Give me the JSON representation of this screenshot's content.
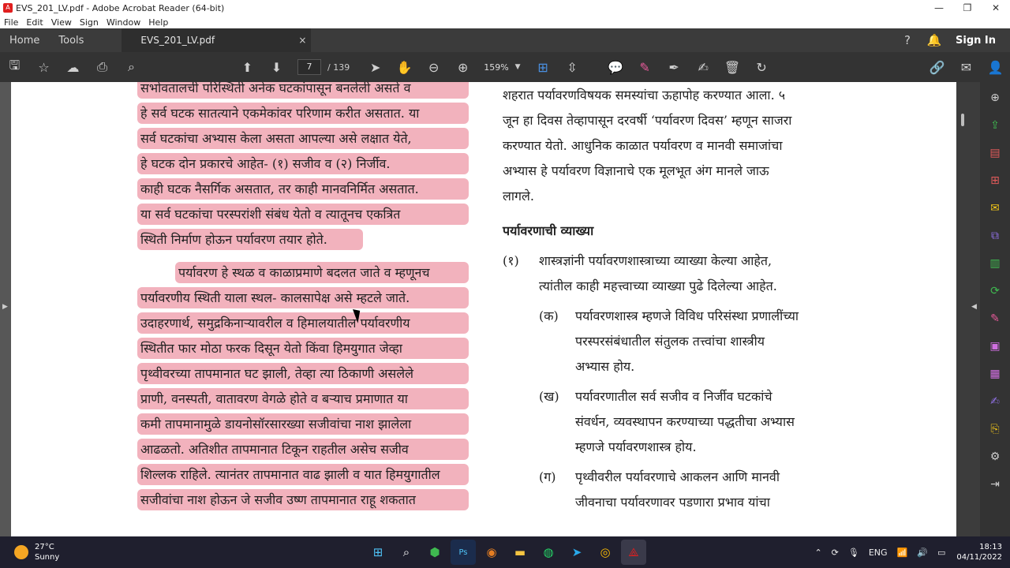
{
  "window": {
    "title": "EVS_201_LV.pdf - Adobe Acrobat Reader (64-bit)",
    "minimize": "—",
    "restore": "❐",
    "close": "✕"
  },
  "menu": [
    "File",
    "Edit",
    "View",
    "Sign",
    "Window",
    "Help"
  ],
  "tabs": {
    "home": "Home",
    "tools": "Tools",
    "document": "EVS_201_LV.pdf",
    "close": "×",
    "sign_in": "Sign In"
  },
  "toolbar": {
    "page_current": "7",
    "page_total": "/ 139",
    "zoom": "159%"
  },
  "document": {
    "left_lines": [
      "सभोवतालची परिस्थिती अनेक घटकांपासून बनलेली असते व",
      "हे सर्व घटक सातत्याने एकमेकांवर परिणाम करीत असतात. या",
      "सर्व घटकांचा अभ्यास केला असता आपल्या असे लक्षात येते,",
      "हे घटक दोन प्रकारचे आहेत- (१) सजीव व (२) निर्जीव.",
      "काही घटक नैसर्गिक असतात, तर काही मानवनिर्मित असतात.",
      "या सर्व घटकांचा परस्परांशी संबंध येतो व त्यातूनच एकत्रित",
      "स्थिती निर्माण होऊन पर्यावरण तयार होते.",
      "पर्यावरण हे स्थळ व काळाप्रमाणे बदलत जाते व म्हणूनच",
      "पर्यावरणीय स्थिती याला स्थल- कालसापेक्ष असे म्हटले जाते.",
      "उदाहरणार्थ, समुद्रकिनाऱ्यावरील व हिमालयातील पर्यावरणीय",
      "स्थितीत फार मोठा फरक दिसून येतो किंवा हिमयुगात जेव्हा",
      "पृथ्वीवरच्या तापमानात घट झाली, तेव्हा त्या ठिकाणी असलेले",
      "प्राणी, वनस्पती, वातावरण वेगळे होते व बऱ्याच प्रमाणात या",
      "कमी तापमानामुळे डायनोसॉरसारख्या सजीवांचा नाश झालेला",
      "आढळतो. अतिशीत तापमानात टिकून राहतील असेच सजीव",
      "शिल्लक राहिले. त्यानंतर तापमानात वाढ झाली व यात हिमयुगातील",
      "सजीवांचा नाश होऊन जे सजीव उष्ण तापमानात राहू शकतात"
    ],
    "right_lines": [
      "शहरात पर्यावरणविषयक समस्यांचा ऊहापोह करण्यात आला. ५",
      "जून हा दिवस तेव्हापासून दरवर्षी ‘पर्यावरण दिवस’ म्हणून साजरा",
      "करण्यात येतो. आधुनिक काळात पर्यावरण व मानवी समाजांचा",
      "अभ्यास हे पर्यावरण विज्ञानाचे एक मूलभूत अंग मानले जाऊ",
      "लागले."
    ],
    "heading": "पर्यावरणाची व्याख्या",
    "item1_num": "(१)",
    "item1_lines": [
      "शास्त्रज्ञांनी पर्यावरणशास्त्राच्या व्याख्या केल्या आहेत,",
      "त्यांतील काही महत्त्वाच्या व्याख्या पुढे दिलेल्या आहेत."
    ],
    "sub_a_num": "(क)",
    "sub_a_lines": [
      "पर्यावरणशास्त्र म्हणजे विविध परिसंस्था प्रणालींच्या",
      "परस्परसंबंधातील संतुलक तत्त्वांचा शास्त्रीय",
      "अभ्यास होय."
    ],
    "sub_b_num": "(ख)",
    "sub_b_lines": [
      "पर्यावरणातील सर्व सजीव व निर्जीव घटकांचे",
      "संवर्धन, व्यवस्थापन करण्याच्या पद्धतीचा अभ्यास",
      "म्हणजे पर्यावरणशास्त्र होय."
    ],
    "sub_c_num": "(ग)",
    "sub_c_lines": [
      "पृथ्वीवरील पर्यावरणाचे आकलन आणि मानवी",
      "जीवनाचा पर्यावरणावर पडणारा प्रभाव यांचा"
    ]
  },
  "taskbar": {
    "temperature": "27°C",
    "weather": "Sunny",
    "language": "ENG",
    "time": "18:13",
    "date": "04/11/2022"
  },
  "colors": {
    "highlight": "#f2b2bd",
    "accent": "#4a90e2"
  }
}
